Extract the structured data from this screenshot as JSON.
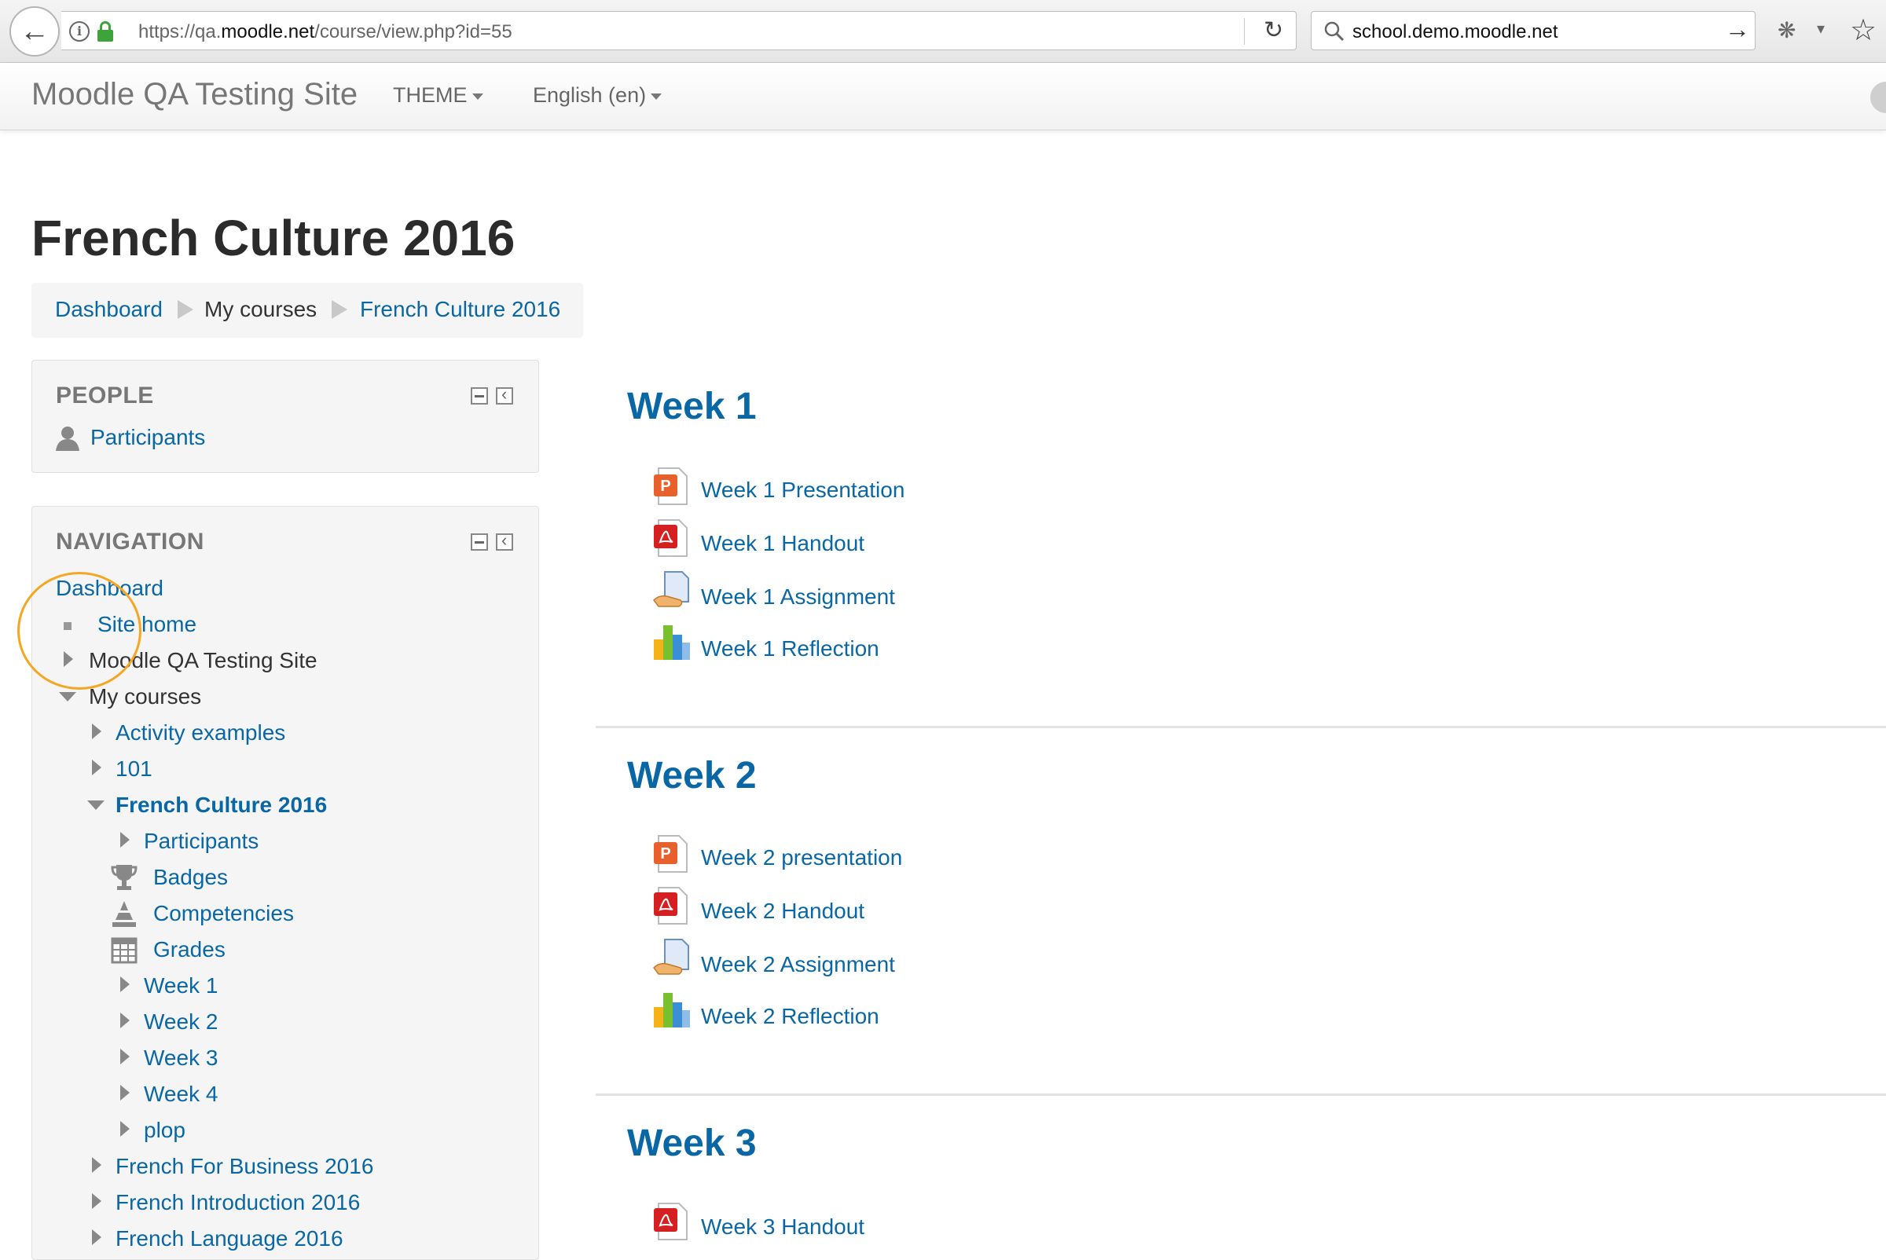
{
  "browser": {
    "url_prefix": "https://qa.",
    "url_host": "moodle.net",
    "url_path": "/course/view.php?id=55",
    "search_value": "school.demo.moodle.net"
  },
  "navbar": {
    "brand": "Moodle QA Testing Site",
    "menus": [
      {
        "label": "THEME"
      },
      {
        "label": "English (en)"
      }
    ]
  },
  "page": {
    "title": "French Culture 2016"
  },
  "breadcrumb": [
    {
      "label": "Dashboard"
    },
    {
      "label": "My courses"
    },
    {
      "label": "French Culture 2016"
    }
  ],
  "people_block": {
    "title": "PEOPLE",
    "participants": "Participants"
  },
  "navigation_block": {
    "title": "NAVIGATION",
    "dashboard": "Dashboard",
    "site_home": "Site home",
    "site": "Moodle QA Testing Site",
    "my_courses": "My courses",
    "courses": [
      "Activity examples",
      "101",
      "French Culture 2016",
      "French For Business 2016",
      "French Introduction 2016",
      "French Language 2016"
    ],
    "current_course_items": [
      "Participants",
      "Badges",
      "Competencies",
      "Grades",
      "Week 1",
      "Week 2",
      "Week 3",
      "Week 4",
      "plop"
    ]
  },
  "sections": [
    {
      "title": "Week 1",
      "activities": [
        {
          "label": "Week 1 Presentation",
          "icon": "powerpoint-icon"
        },
        {
          "label": "Week 1 Handout",
          "icon": "pdf-icon"
        },
        {
          "label": "Week 1 Assignment",
          "icon": "assignment-icon"
        },
        {
          "label": "Week 1 Reflection",
          "icon": "feedback-chart-icon"
        }
      ]
    },
    {
      "title": "Week 2",
      "activities": [
        {
          "label": "Week 2 presentation",
          "icon": "powerpoint-icon"
        },
        {
          "label": "Week 2 Handout",
          "icon": "pdf-icon"
        },
        {
          "label": "Week 2 Assignment",
          "icon": "assignment-icon"
        },
        {
          "label": "Week 2 Reflection",
          "icon": "feedback-chart-icon"
        }
      ]
    },
    {
      "title": "Week 3",
      "activities": [
        {
          "label": "Week 3 Handout",
          "icon": "pdf-icon"
        }
      ]
    }
  ],
  "colors": {
    "link": "#0a67a5",
    "highlight_circle": "#f5a623"
  }
}
